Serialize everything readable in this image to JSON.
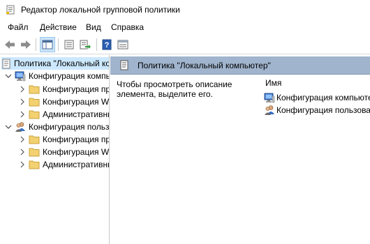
{
  "window": {
    "title": "Редактор локальной групповой политики"
  },
  "menu": {
    "items": [
      "Файл",
      "Действие",
      "Вид",
      "Справка"
    ]
  },
  "toolbar": {
    "buttons": [
      "back-icon",
      "forward-icon",
      "show-tree-icon",
      "properties-icon",
      "export-list-icon",
      "help-icon",
      "extended-view-icon"
    ]
  },
  "tree": {
    "root": {
      "label": "Политика \"Локальный компьютер\"",
      "icon": "policy-document-icon"
    },
    "computer": {
      "label": "Конфигурация компьютера",
      "icon": "computer-icon",
      "children": [
        {
          "label": "Конфигурация программ",
          "icon": "folder-icon"
        },
        {
          "label": "Конфигурация Windows",
          "icon": "folder-icon"
        },
        {
          "label": "Административные шаблоны",
          "icon": "folder-icon"
        }
      ]
    },
    "user": {
      "label": "Конфигурация пользователя",
      "icon": "users-icon",
      "children": [
        {
          "label": "Конфигурация программ",
          "icon": "folder-icon"
        },
        {
          "label": "Конфигурация Windows",
          "icon": "folder-icon"
        },
        {
          "label": "Административные шаблоны",
          "icon": "folder-icon"
        }
      ]
    }
  },
  "details": {
    "header": "Политика \"Локальный компьютер\"",
    "description": "Чтобы просмотреть описание элемента, выделите его.",
    "column_name": "Имя",
    "rows": [
      {
        "label": "Конфигурация компьютера",
        "icon": "computer-icon"
      },
      {
        "label": "Конфигурация пользователя",
        "icon": "users-icon"
      }
    ]
  },
  "colors": {
    "header_bg": "#a0b4cd",
    "selection": "#cce8ff"
  }
}
